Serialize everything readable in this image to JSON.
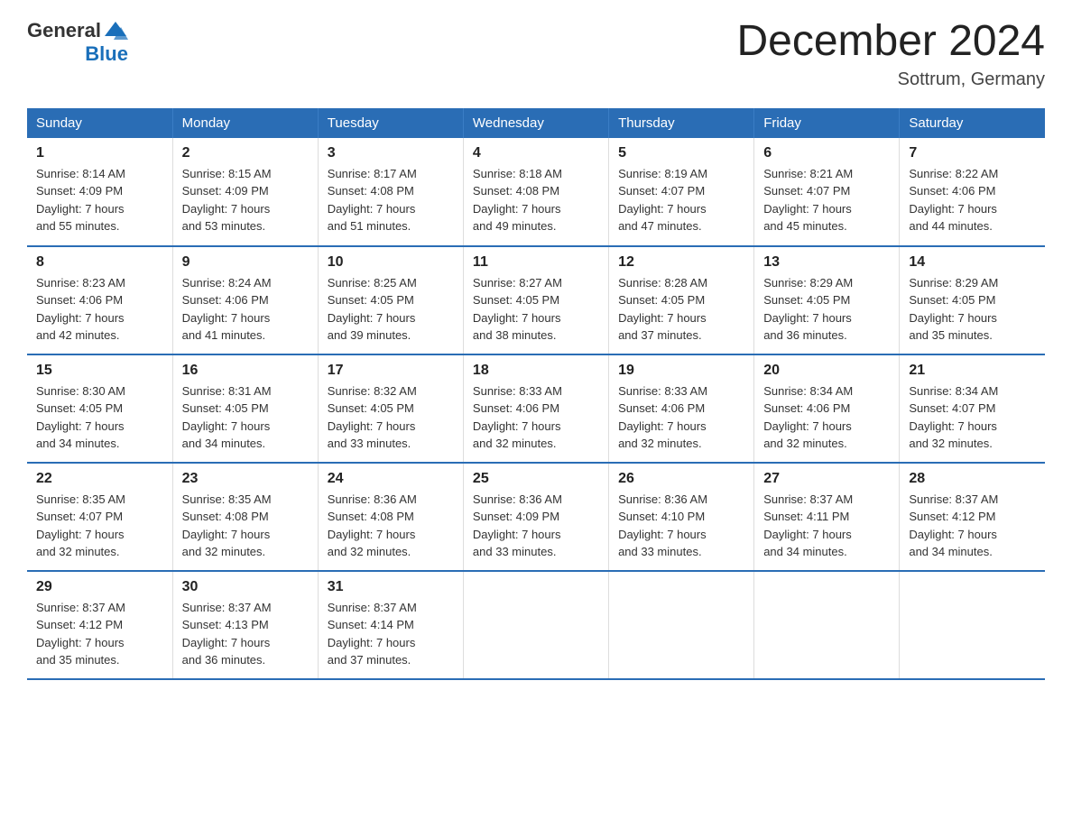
{
  "header": {
    "logo_general": "General",
    "logo_blue": "Blue",
    "title": "December 2024",
    "location": "Sottrum, Germany"
  },
  "days_of_week": [
    "Sunday",
    "Monday",
    "Tuesday",
    "Wednesday",
    "Thursday",
    "Friday",
    "Saturday"
  ],
  "weeks": [
    [
      {
        "day": "1",
        "sunrise": "8:14 AM",
        "sunset": "4:09 PM",
        "daylight": "7 hours and 55 minutes."
      },
      {
        "day": "2",
        "sunrise": "8:15 AM",
        "sunset": "4:09 PM",
        "daylight": "7 hours and 53 minutes."
      },
      {
        "day": "3",
        "sunrise": "8:17 AM",
        "sunset": "4:08 PM",
        "daylight": "7 hours and 51 minutes."
      },
      {
        "day": "4",
        "sunrise": "8:18 AM",
        "sunset": "4:08 PM",
        "daylight": "7 hours and 49 minutes."
      },
      {
        "day": "5",
        "sunrise": "8:19 AM",
        "sunset": "4:07 PM",
        "daylight": "7 hours and 47 minutes."
      },
      {
        "day": "6",
        "sunrise": "8:21 AM",
        "sunset": "4:07 PM",
        "daylight": "7 hours and 45 minutes."
      },
      {
        "day": "7",
        "sunrise": "8:22 AM",
        "sunset": "4:06 PM",
        "daylight": "7 hours and 44 minutes."
      }
    ],
    [
      {
        "day": "8",
        "sunrise": "8:23 AM",
        "sunset": "4:06 PM",
        "daylight": "7 hours and 42 minutes."
      },
      {
        "day": "9",
        "sunrise": "8:24 AM",
        "sunset": "4:06 PM",
        "daylight": "7 hours and 41 minutes."
      },
      {
        "day": "10",
        "sunrise": "8:25 AM",
        "sunset": "4:05 PM",
        "daylight": "7 hours and 39 minutes."
      },
      {
        "day": "11",
        "sunrise": "8:27 AM",
        "sunset": "4:05 PM",
        "daylight": "7 hours and 38 minutes."
      },
      {
        "day": "12",
        "sunrise": "8:28 AM",
        "sunset": "4:05 PM",
        "daylight": "7 hours and 37 minutes."
      },
      {
        "day": "13",
        "sunrise": "8:29 AM",
        "sunset": "4:05 PM",
        "daylight": "7 hours and 36 minutes."
      },
      {
        "day": "14",
        "sunrise": "8:29 AM",
        "sunset": "4:05 PM",
        "daylight": "7 hours and 35 minutes."
      }
    ],
    [
      {
        "day": "15",
        "sunrise": "8:30 AM",
        "sunset": "4:05 PM",
        "daylight": "7 hours and 34 minutes."
      },
      {
        "day": "16",
        "sunrise": "8:31 AM",
        "sunset": "4:05 PM",
        "daylight": "7 hours and 34 minutes."
      },
      {
        "day": "17",
        "sunrise": "8:32 AM",
        "sunset": "4:05 PM",
        "daylight": "7 hours and 33 minutes."
      },
      {
        "day": "18",
        "sunrise": "8:33 AM",
        "sunset": "4:06 PM",
        "daylight": "7 hours and 32 minutes."
      },
      {
        "day": "19",
        "sunrise": "8:33 AM",
        "sunset": "4:06 PM",
        "daylight": "7 hours and 32 minutes."
      },
      {
        "day": "20",
        "sunrise": "8:34 AM",
        "sunset": "4:06 PM",
        "daylight": "7 hours and 32 minutes."
      },
      {
        "day": "21",
        "sunrise": "8:34 AM",
        "sunset": "4:07 PM",
        "daylight": "7 hours and 32 minutes."
      }
    ],
    [
      {
        "day": "22",
        "sunrise": "8:35 AM",
        "sunset": "4:07 PM",
        "daylight": "7 hours and 32 minutes."
      },
      {
        "day": "23",
        "sunrise": "8:35 AM",
        "sunset": "4:08 PM",
        "daylight": "7 hours and 32 minutes."
      },
      {
        "day": "24",
        "sunrise": "8:36 AM",
        "sunset": "4:08 PM",
        "daylight": "7 hours and 32 minutes."
      },
      {
        "day": "25",
        "sunrise": "8:36 AM",
        "sunset": "4:09 PM",
        "daylight": "7 hours and 33 minutes."
      },
      {
        "day": "26",
        "sunrise": "8:36 AM",
        "sunset": "4:10 PM",
        "daylight": "7 hours and 33 minutes."
      },
      {
        "day": "27",
        "sunrise": "8:37 AM",
        "sunset": "4:11 PM",
        "daylight": "7 hours and 34 minutes."
      },
      {
        "day": "28",
        "sunrise": "8:37 AM",
        "sunset": "4:12 PM",
        "daylight": "7 hours and 34 minutes."
      }
    ],
    [
      {
        "day": "29",
        "sunrise": "8:37 AM",
        "sunset": "4:12 PM",
        "daylight": "7 hours and 35 minutes."
      },
      {
        "day": "30",
        "sunrise": "8:37 AM",
        "sunset": "4:13 PM",
        "daylight": "7 hours and 36 minutes."
      },
      {
        "day": "31",
        "sunrise": "8:37 AM",
        "sunset": "4:14 PM",
        "daylight": "7 hours and 37 minutes."
      },
      null,
      null,
      null,
      null
    ]
  ],
  "labels": {
    "sunrise": "Sunrise:",
    "sunset": "Sunset:",
    "daylight": "Daylight:"
  }
}
